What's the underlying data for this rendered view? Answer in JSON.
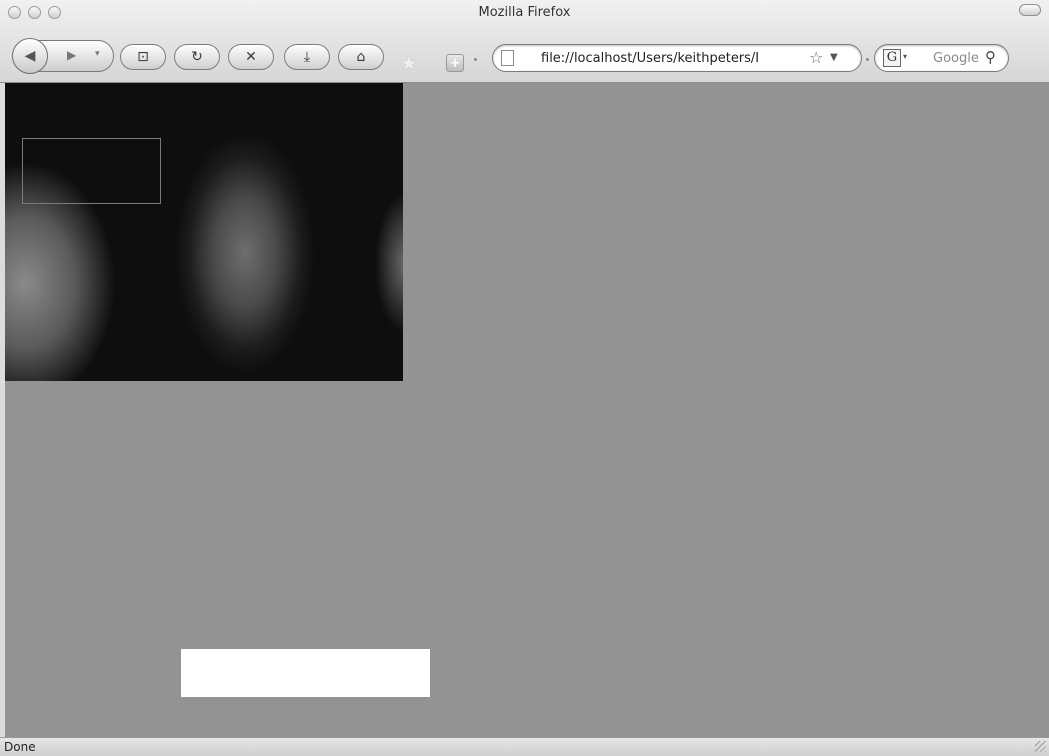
{
  "window": {
    "title": "Mozilla Firefox"
  },
  "toolbar": {
    "url": "file://localhost/Users/keithpeters/I",
    "search_placeholder": "Google",
    "search_engine_letter": "G",
    "icons": [
      "back-icon",
      "forward-icon",
      "history-dropdown-icon",
      "full-screen-icon",
      "reload-icon",
      "stop-icon",
      "download-icon",
      "home-icon",
      "bookmark-star-icon",
      "add-icon",
      "page-icon",
      "url-star-icon",
      "url-dropdown-icon",
      "google-icon",
      "magnifier-icon"
    ]
  },
  "status": {
    "text": "Done"
  },
  "colors": {
    "page_background": "#939393",
    "chrome": "#d6d6d6"
  }
}
